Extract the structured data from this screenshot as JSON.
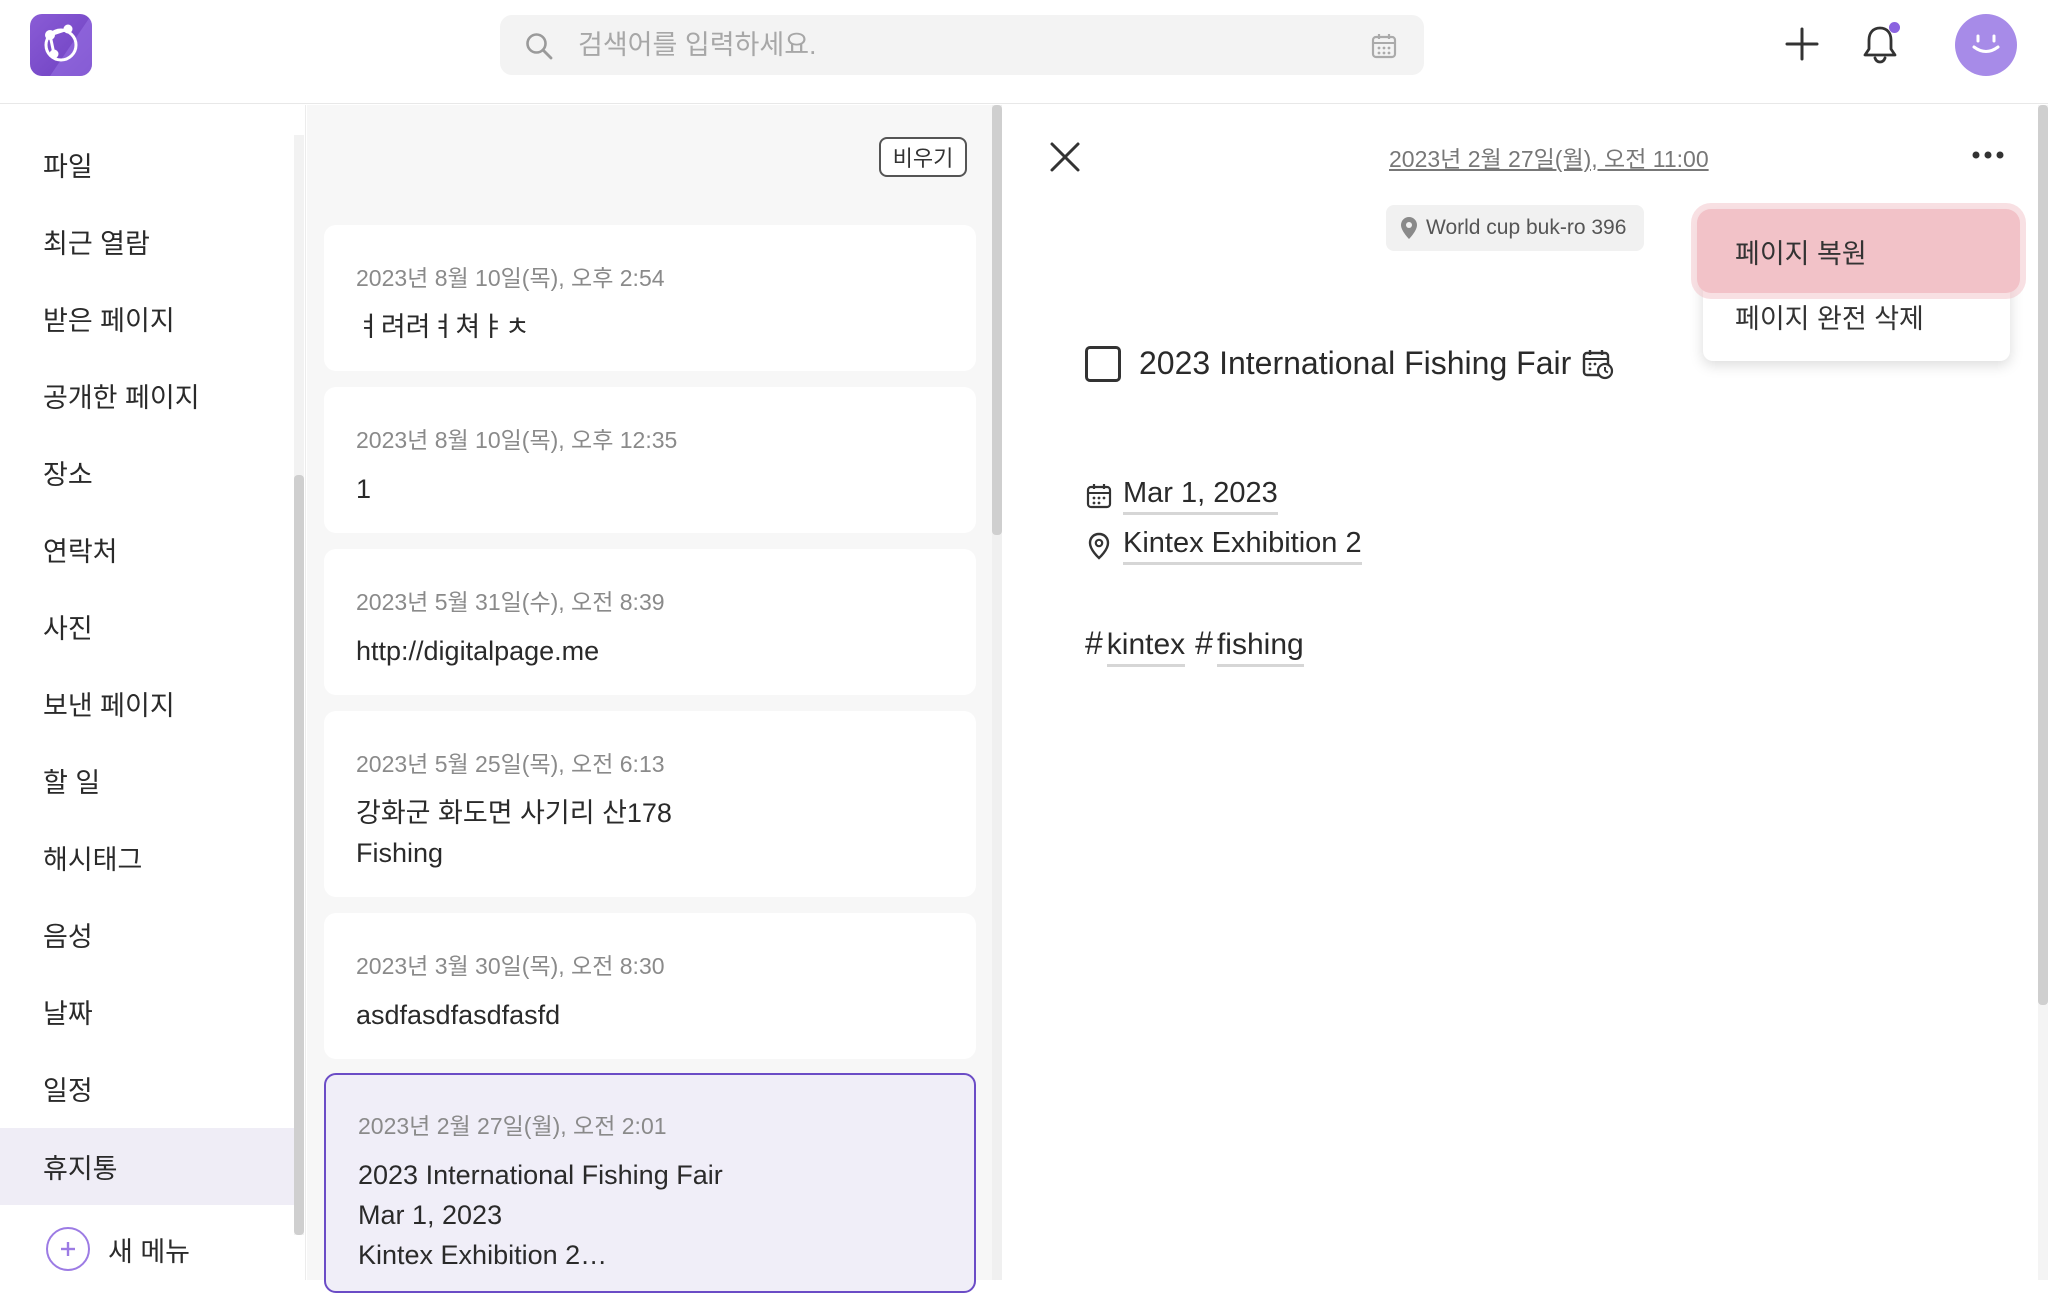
{
  "header": {
    "search_placeholder": "검색어를 입력하세요.",
    "accent": "#7a4fd0"
  },
  "sidebar": {
    "items": [
      {
        "label": "파일"
      },
      {
        "label": "최근 열람"
      },
      {
        "label": "받은 페이지"
      },
      {
        "label": "공개한 페이지"
      },
      {
        "label": "장소"
      },
      {
        "label": "연락처"
      },
      {
        "label": "사진"
      },
      {
        "label": "보낸 페이지"
      },
      {
        "label": "할 일"
      },
      {
        "label": "해시태그"
      },
      {
        "label": "음성"
      },
      {
        "label": "날짜"
      },
      {
        "label": "일정"
      },
      {
        "label": "휴지통"
      }
    ],
    "active_index": 13,
    "new_menu_label": "새 메뉴"
  },
  "list": {
    "empty_button": "비우기",
    "cards": [
      {
        "date": "2023년 8월 10일(목), 오후 2:54",
        "lines": [
          "ㅕ려려ㅕ쳐ㅑㅊ"
        ]
      },
      {
        "date": "2023년 8월 10일(목), 오후 12:35",
        "lines": [
          "1"
        ]
      },
      {
        "date": "2023년 5월 31일(수), 오전 8:39",
        "lines": [
          "http://digitalpage.me"
        ]
      },
      {
        "date": "2023년 5월 25일(목), 오전 6:13",
        "lines": [
          "강화군 화도면 사기리 산178",
          "Fishing"
        ]
      },
      {
        "date": "2023년 3월 30일(목), 오전 8:30",
        "lines": [
          "asdfasdfasdfasfd"
        ]
      },
      {
        "date": "2023년 2월 27일(월), 오전 2:01",
        "lines": [
          "2023 International Fishing Fair",
          "Mar 1, 2023",
          "Kintex Exhibition 2…"
        ],
        "selected": true
      }
    ]
  },
  "detail": {
    "date": "2023년 2월 27일(월), 오전 11:00",
    "location_chip": "World cup buk-ro 396",
    "title": "2023 International Fishing Fair",
    "event_date": "Mar 1, 2023",
    "event_location": "Kintex Exhibition 2",
    "tags": [
      "kintex",
      "fishing"
    ]
  },
  "menu": {
    "items": [
      "페이지 복원",
      "페이지 완전 삭제"
    ],
    "highlighted_index": 0
  }
}
